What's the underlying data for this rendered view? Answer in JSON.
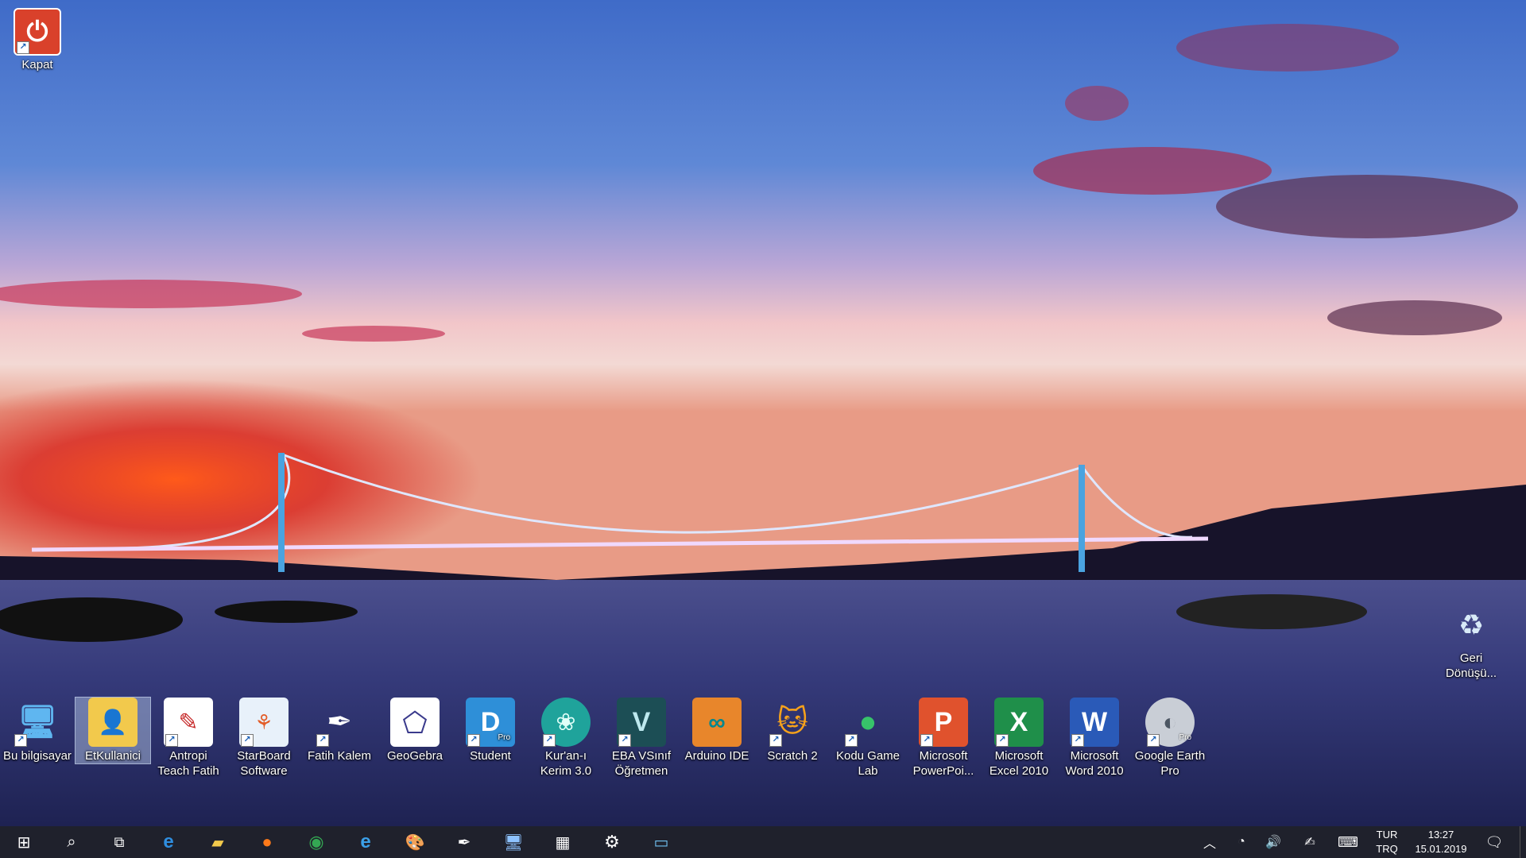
{
  "desktop": {
    "top_icons": [
      {
        "label": "Kapat",
        "icon": "power-icon",
        "color": "#d9412b"
      }
    ],
    "bottom_icons": [
      {
        "label": "Bu bilgisayar",
        "icon": "computer-icon"
      },
      {
        "label": "EtKullanici",
        "icon": "user-folder-icon",
        "selected": true
      },
      {
        "label": "Antropi Teach Fatih",
        "icon": "antropi-icon"
      },
      {
        "label": "StarBoard Software",
        "icon": "starboard-icon"
      },
      {
        "label": "Fatih Kalem",
        "icon": "pen-icon"
      },
      {
        "label": "GeoGebra",
        "icon": "geogebra-icon"
      },
      {
        "label": "Student",
        "icon": "student-pro-icon",
        "badge": "Pro"
      },
      {
        "label": "Kur'an-ı Kerim 3.0",
        "icon": "quran-icon"
      },
      {
        "label": "EBA VSınıf Öğretmen",
        "icon": "eba-icon"
      },
      {
        "label": "Arduino IDE",
        "icon": "arduino-icon"
      },
      {
        "label": "Scratch 2",
        "icon": "scratch-icon"
      },
      {
        "label": "Kodu Game Lab",
        "icon": "kodu-icon"
      },
      {
        "label": "Microsoft PowerPoi...",
        "icon": "powerpoint-icon"
      },
      {
        "label": "Microsoft Excel 2010",
        "icon": "excel-icon"
      },
      {
        "label": "Microsoft Word 2010",
        "icon": "word-icon"
      },
      {
        "label": "Google Earth Pro",
        "icon": "google-earth-icon",
        "badge": "Pro"
      }
    ],
    "recycle_bin": {
      "label": "Geri Dönüşü...",
      "icon": "recycle-bin-icon"
    }
  },
  "taskbar": {
    "items": [
      {
        "name": "start-icon"
      },
      {
        "name": "search-icon"
      },
      {
        "name": "task-view-icon"
      },
      {
        "name": "edge-icon"
      },
      {
        "name": "file-explorer-icon"
      },
      {
        "name": "firefox-icon"
      },
      {
        "name": "chrome-icon"
      },
      {
        "name": "internet-explorer-icon"
      },
      {
        "name": "paint-icon"
      },
      {
        "name": "pen-tool-icon"
      },
      {
        "name": "remote-desktop-icon"
      },
      {
        "name": "calculator-icon"
      },
      {
        "name": "settings-icon"
      },
      {
        "name": "id-card-icon"
      }
    ],
    "tray": {
      "language": "TUR",
      "language_sub": "TRQ",
      "time": "13:27",
      "date": "15.01.2019"
    }
  },
  "colors": {
    "taskbar_bg": "#0e101c",
    "selection": "#bed2f0",
    "sky_top": "#3c67c2",
    "sunset": "#e8331c",
    "water": "#2a2e63"
  }
}
